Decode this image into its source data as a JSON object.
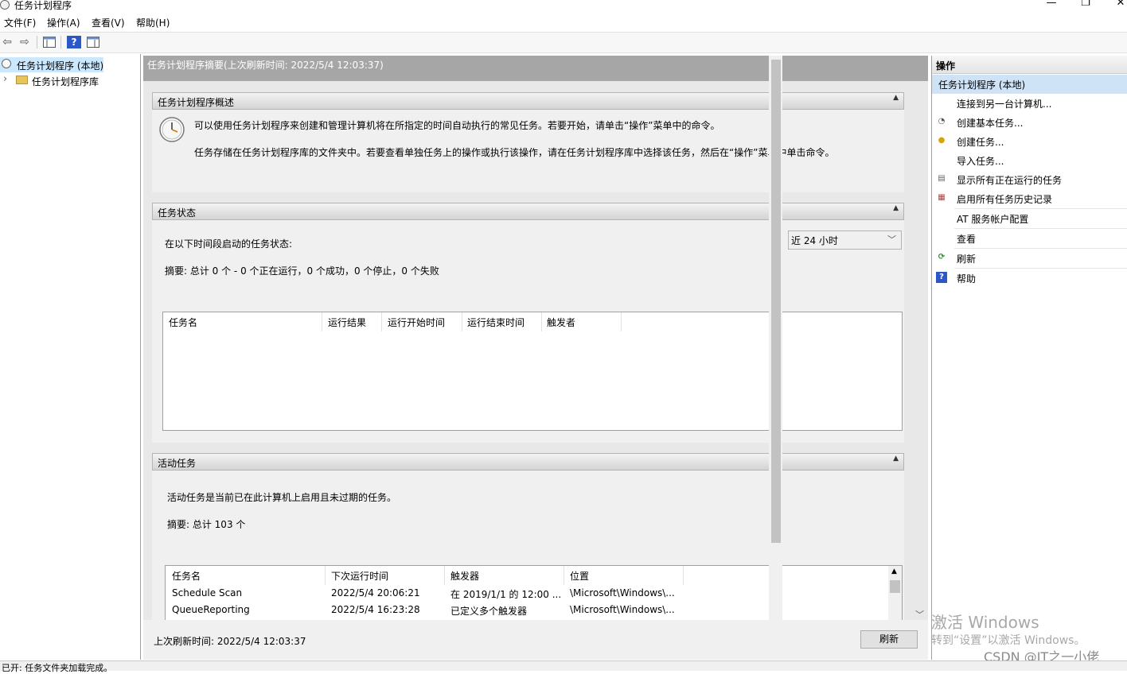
{
  "window": {
    "title": "任务计划程序",
    "minimize": "—",
    "maximize": "❐",
    "close": "✕"
  },
  "menu": [
    "文件(F)",
    "操作(A)",
    "查看(V)",
    "帮助(H)"
  ],
  "toolbar": {
    "back_icon": "⇦",
    "forward_icon": "⇨",
    "help_icon": "?"
  },
  "tree": {
    "root": "任务计划程序 (本地)",
    "library": "任务计划程序库",
    "expand_glyph": "›"
  },
  "center": {
    "header": "任务计划程序摘要(上次刷新时间: 2022/5/4 12:03:37)",
    "overview": {
      "title": "任务计划程序概述",
      "line1": "可以使用任务计划程序来创建和管理计算机将在所指定的时间自动执行的常见任务。若要开始，请单击“操作”菜单中的命令。",
      "line2": "任务存储在任务计划程序库的文件夹中。若要查看单独任务上的操作或执行该操作，请在任务计划程序库中选择该任务，然后在“操作”菜单中单击命令。"
    },
    "status": {
      "title": "任务状态",
      "period_label": "在以下时间段启动的任务状态:",
      "period_value": "近 24 小时",
      "summary": "摘要: 总计 0 个 - 0 个正在运行，0 个成功，0 个停止，0 个失败",
      "columns": [
        "任务名",
        "运行结果",
        "运行开始时间",
        "运行结束时间",
        "触发者"
      ]
    },
    "active": {
      "title": "活动任务",
      "desc": "活动任务是当前已在此计算机上启用且未过期的任务。",
      "summary": "摘要: 总计 103 个",
      "columns": [
        "任务名",
        "下次运行时间",
        "触发器",
        "位置"
      ],
      "rows": [
        [
          "Schedule Scan",
          "2022/5/4 20:06:21",
          "在 2019/1/1 的 12:00 ...",
          "\\Microsoft\\Windows\\..."
        ],
        [
          "QueueReporting",
          "2022/5/4 16:23:28",
          "已定义多个触发器",
          "\\Microsoft\\Windows\\..."
        ]
      ]
    },
    "last_refresh": "上次刷新时间: 2022/5/4 12:03:37",
    "refresh_button": "刷新",
    "collapse_glyph": "▲"
  },
  "actions": {
    "header": "操作",
    "subheader": "任务计划程序 (本地)",
    "items": [
      {
        "label": "连接到另一台计算机...",
        "icon": ""
      },
      {
        "label": "创建基本任务...",
        "icon": "◔"
      },
      {
        "label": "创建任务...",
        "icon": "●"
      },
      {
        "label": "导入任务...",
        "icon": ""
      },
      {
        "label": "显示所有正在运行的任务",
        "icon": "▤"
      },
      {
        "label": "启用所有任务历史记录",
        "icon": "▦"
      },
      {
        "label": "AT 服务帐户配置",
        "icon": ""
      },
      {
        "label": "查看",
        "icon": ""
      },
      {
        "label": "刷新",
        "icon": "⟳"
      },
      {
        "label": "帮助",
        "icon": "?"
      }
    ]
  },
  "statusbar": "已开: 任务文件夹加载完成。",
  "watermark": {
    "line1": "激活 Windows",
    "line2": "转到“设置”以激活 Windows。",
    "credit": "CSDN @IT之一小佬"
  }
}
